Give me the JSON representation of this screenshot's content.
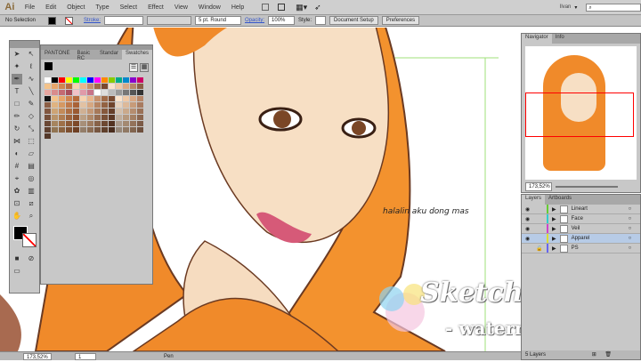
{
  "app": {
    "logo": "Ai",
    "menus": [
      "File",
      "Edit",
      "Object",
      "Type",
      "Select",
      "Effect",
      "View",
      "Window",
      "Help"
    ],
    "user": "Ilvan",
    "search_placeholder": ""
  },
  "control": {
    "selection": "No Selection",
    "stroke_label": "Stroke:",
    "brush": "5 pt. Round",
    "opacity_label": "Opacity:",
    "opacity": "100%",
    "style_label": "Style:",
    "doc_setup": "Document Setup",
    "preferences": "Preferences"
  },
  "swatches": {
    "tabs": [
      "PANTONE",
      "Basic RC",
      "Standar",
      "Swatches"
    ],
    "colors": [
      "#ffffff",
      "#000000",
      "#ff0000",
      "#ffff00",
      "#00ff00",
      "#00ffff",
      "#0000ff",
      "#ff00ff",
      "#ff8800",
      "#88cc00",
      "#00aa88",
      "#0088cc",
      "#8800cc",
      "#cc0066",
      "#f4c38b",
      "#e8a56a",
      "#d08450",
      "#b86b3c",
      "#f6d2b0",
      "#e9b58c",
      "#c7906a",
      "#a06a48",
      "#7a4a30",
      "#fbe3cc",
      "#f0c9a6",
      "#d8a884",
      "#b78668",
      "#8c5f46",
      "#e6a6a0",
      "#d98c8c",
      "#c46a72",
      "#a84e5c",
      "#f2c2c8",
      "#e09aa8",
      "#c87488",
      "#ffffff",
      "#dddddd",
      "#bbbbbb",
      "#999999",
      "#777777",
      "#555555",
      "#333333",
      "#111111"
    ]
  },
  "navigator": {
    "tabs": [
      "Navigator",
      "Info"
    ],
    "zoom": "173,52%"
  },
  "layers": {
    "tabs": [
      "Layers",
      "Artboards"
    ],
    "items": [
      {
        "name": "Lineart",
        "color": "#66cc33",
        "selected": false,
        "locked": false
      },
      {
        "name": "Face",
        "color": "#33cccc",
        "selected": false,
        "locked": false
      },
      {
        "name": "Veil",
        "color": "#cc44cc",
        "selected": false,
        "locked": false
      },
      {
        "name": "Apparel",
        "color": "#dddd33",
        "selected": true,
        "locked": false
      },
      {
        "name": "PS",
        "color": "#6666ee",
        "selected": false,
        "locked": true
      }
    ],
    "count": "5 Layers"
  },
  "status": {
    "zoom": "173,52%",
    "artboard": "1",
    "tool": "Pen"
  },
  "canvas": {
    "caption": "halalin aku dong mas"
  },
  "watermark": {
    "brand": "Sketchmob.com",
    "sub": "- watermark -"
  }
}
